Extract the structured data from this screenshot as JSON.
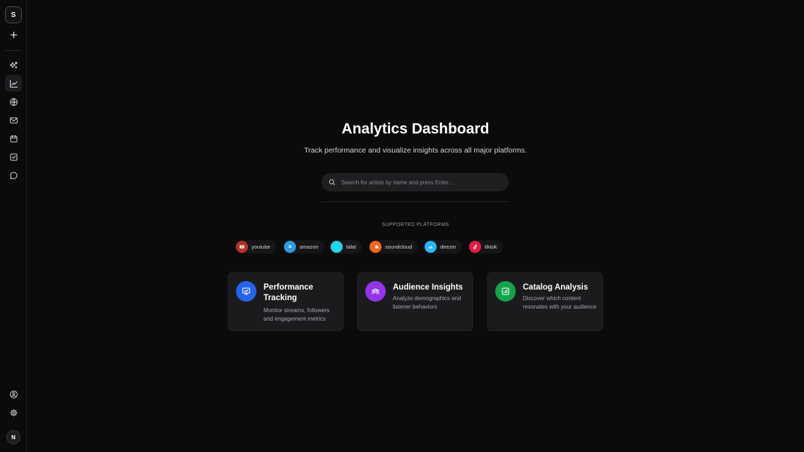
{
  "sidebar": {
    "workspace_initial": "S",
    "user_initial": "N",
    "items": [
      {
        "icon": "plus-icon"
      },
      {
        "icon": "sparkles-icon"
      },
      {
        "icon": "line-chart-icon",
        "active": true
      },
      {
        "icon": "globe-icon"
      },
      {
        "icon": "mail-icon"
      },
      {
        "icon": "calendar-icon"
      },
      {
        "icon": "checkbox-icon"
      },
      {
        "icon": "chat-bubble-icon"
      },
      {
        "icon": "user-circle-icon"
      },
      {
        "icon": "gear-icon"
      }
    ]
  },
  "main": {
    "title": "Analytics Dashboard",
    "subtitle": "Track performance and visualize insights across all major platforms.",
    "search": {
      "placeholder": "Search for artists by name and press Enter...",
      "value": ""
    },
    "platforms_label": "SUPPORTED PLATFORMS",
    "platforms": [
      {
        "name": "youtube",
        "color": "#c0392b"
      },
      {
        "name": "amazon",
        "color": "#2f9ae0"
      },
      {
        "name": "tidal",
        "color": "#22d3ee"
      },
      {
        "name": "soundcloud",
        "color": "#f26522"
      },
      {
        "name": "deezer",
        "color": "#29b6f6"
      },
      {
        "name": "tiktok",
        "color": "#e11d48"
      }
    ],
    "cards": [
      {
        "title": "Performance Tracking",
        "description": "Monitor streams, followers and engagement metrics",
        "icon": "presentation-chart-icon",
        "color": "#2563eb"
      },
      {
        "title": "Audience Insights",
        "description": "Analyze demographics and listener behaviors",
        "icon": "users-icon",
        "color": "#9333ea"
      },
      {
        "title": "Catalog Analysis",
        "description": "Discover which content resonates with your audience",
        "icon": "bar-chart-icon",
        "color": "#16a34a"
      }
    ]
  }
}
